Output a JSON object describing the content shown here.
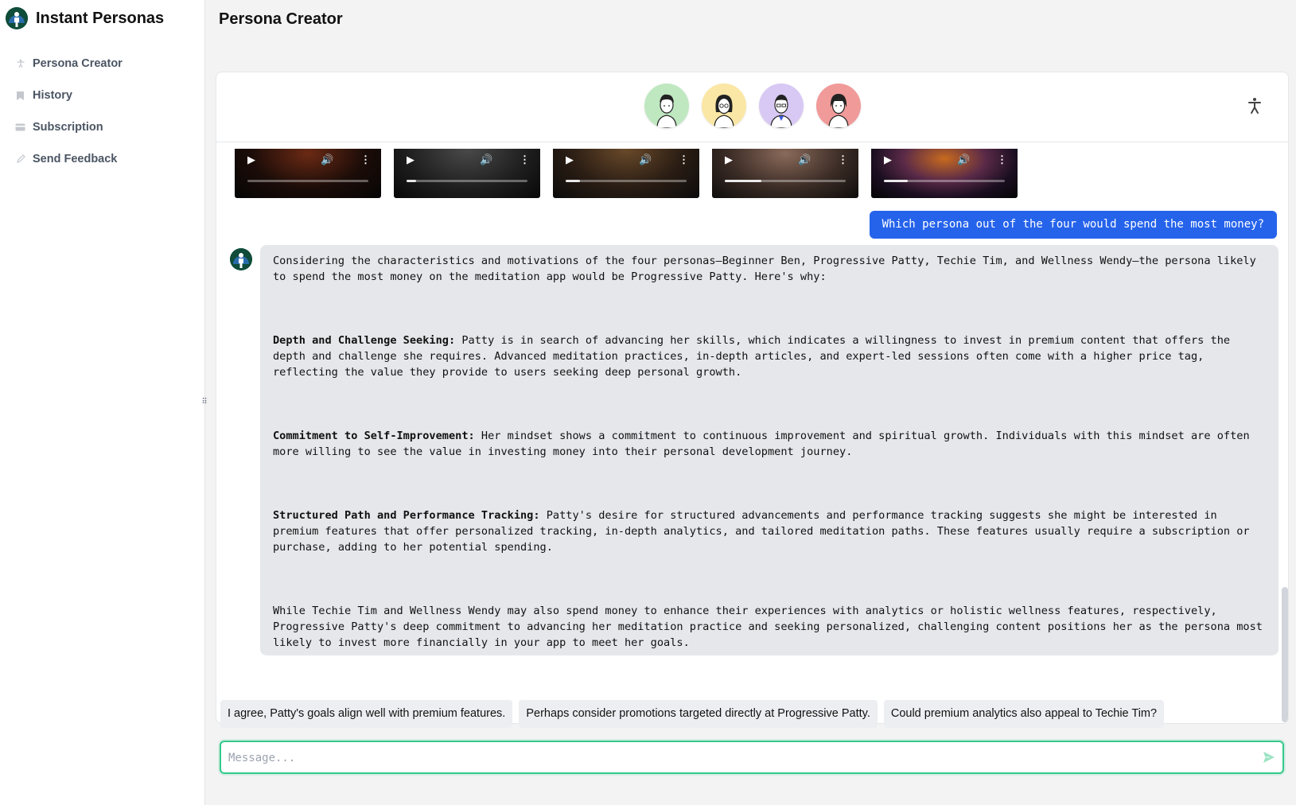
{
  "app": {
    "name": "Instant Personas"
  },
  "sidebar": {
    "items": [
      {
        "label": "Persona Creator",
        "icon": "accessibility-icon"
      },
      {
        "label": "History",
        "icon": "bookmark-icon"
      },
      {
        "label": "Subscription",
        "icon": "card-icon"
      },
      {
        "label": "Send Feedback",
        "icon": "pencil-icon"
      }
    ]
  },
  "header": {
    "title": "Persona Creator"
  },
  "personas": [
    {
      "color": "#bfe8c1",
      "icon": "persona-avatar-icon"
    },
    {
      "color": "#fbe7a5",
      "icon": "persona-avatar-icon"
    },
    {
      "color": "#d8c8f4",
      "icon": "persona-avatar-icon"
    },
    {
      "color": "#f19a9a",
      "icon": "persona-avatar-icon"
    }
  ],
  "videos": [
    {
      "progress": 0
    },
    {
      "progress": 0.08
    },
    {
      "progress": 0.12
    },
    {
      "progress": 0.3
    },
    {
      "progress": 0.2
    }
  ],
  "chat": {
    "user_message": "Which persona out of the four would spend the most money?",
    "assistant": {
      "intro": "Considering the characteristics and motivations of the four personas—Beginner Ben, Progressive Patty, Techie Tim, and Wellness Wendy—the persona likely to spend the most money on the meditation app would be Progressive Patty. Here's why:",
      "points": [
        {
          "title": "Depth and Challenge Seeking:",
          "text": " Patty is in search of advancing her skills, which indicates a willingness to invest in premium content that offers the depth and challenge she requires. Advanced meditation practices, in-depth articles, and expert-led sessions often come with a higher price tag, reflecting the value they provide to users seeking deep personal growth."
        },
        {
          "title": "Commitment to Self-Improvement:",
          "text": " Her mindset shows a commitment to continuous improvement and spiritual growth. Individuals with this mindset are often more willing to see the value in investing money into their personal development journey."
        },
        {
          "title": "Structured Path and Performance Tracking:",
          "text": " Patty's desire for structured advancements and performance tracking suggests she might be interested in premium features that offer personalized tracking, in-depth analytics, and tailored meditation paths. These features usually require a subscription or purchase, adding to her potential spending."
        }
      ],
      "conclusion": "While Techie Tim and Wellness Wendy may also spend money to enhance their experiences with analytics or holistic wellness features, respectively, Progressive Patty's deep commitment to advancing her meditation practice and seeking personalized, challenging content positions her as the persona most likely to invest more financially in your app to meet her goals."
    }
  },
  "suggestions": [
    "I agree, Patty's goals align well with premium features.",
    "Perhaps consider promotions targeted directly at Progressive Patty.",
    "Could premium analytics also appeal to Techie Tim?"
  ],
  "composer": {
    "placeholder": "Message...",
    "value": ""
  },
  "colors": {
    "accent": "#2563eb",
    "focus": "#34c98b",
    "brand": "#0f4c3a"
  }
}
